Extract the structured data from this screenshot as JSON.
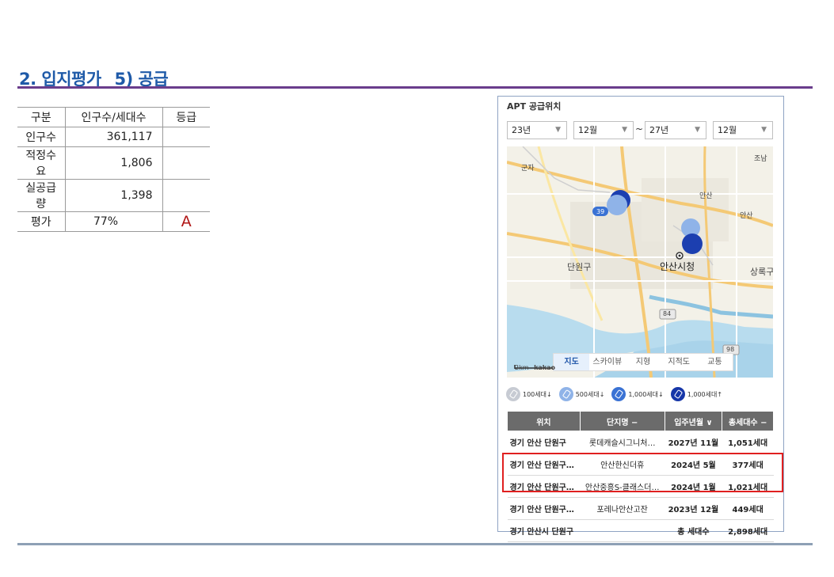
{
  "page": {
    "title": "2. 입지평가_ 5) 공급",
    "colors": {
      "title": "#1f5aa8",
      "rule": "#6a3d8c",
      "grade": "#b01515",
      "highlight": "#e02020"
    }
  },
  "supply_table": {
    "headers": [
      "구분",
      "인구수/세대수",
      "등급"
    ],
    "rows": [
      {
        "label": "인구수",
        "value": "361,117",
        "grade": ""
      },
      {
        "label": "적정수요",
        "value": "1,806",
        "grade": ""
      },
      {
        "label": "실공급량",
        "value": "1,398",
        "grade": ""
      },
      {
        "label": "평가",
        "value": "77%",
        "grade": "A"
      }
    ]
  },
  "panel": {
    "title": "APT 공급위치",
    "filters": {
      "from_year": "23년",
      "from_month": "12월",
      "tilde": "~",
      "to_year": "27년",
      "to_month": "12월"
    },
    "map": {
      "labels": [
        "군자",
        "안산",
        "조남",
        "단원구",
        "안산시청",
        "상록구"
      ],
      "route_badges": [
        "39",
        "84",
        "98"
      ],
      "tabs": [
        "지도",
        "스카이뷰",
        "지형",
        "지적도",
        "교통"
      ],
      "active_tab": "지도",
      "scale_label": "2km",
      "logo": "kakao"
    },
    "legend": [
      {
        "label": "100세대↓",
        "color": "#c7cbd3"
      },
      {
        "label": "500세대↓",
        "color": "#8fb3e8"
      },
      {
        "label": "1,000세대↓",
        "color": "#3a72d4"
      },
      {
        "label": "1,000세대↑",
        "color": "#1636a8"
      }
    ],
    "list": {
      "headers": [
        "위치",
        "단지명 −",
        "입주년월 ∨",
        "총세대수 −"
      ],
      "rows": [
        {
          "loc": "경기 안산 단원구",
          "name": "롯데캐슬시그니처…",
          "date": "2027년 11월",
          "units": "1,051세대"
        },
        {
          "loc": "경기 안산 단원구…",
          "name": "안산한신더휴",
          "date": "2024년 5월",
          "units": "377세대"
        },
        {
          "loc": "경기 안산 단원구…",
          "name": "안산중흥S-클래스더…",
          "date": "2024년 1월",
          "units": "1,021세대"
        },
        {
          "loc": "경기 안산 단원구…",
          "name": "포레나안산고잔",
          "date": "2023년 12월",
          "units": "449세대"
        },
        {
          "loc": "경기 안산시 단원구",
          "name": "",
          "date": "총 세대수",
          "units": "2,898세대"
        }
      ]
    }
  }
}
